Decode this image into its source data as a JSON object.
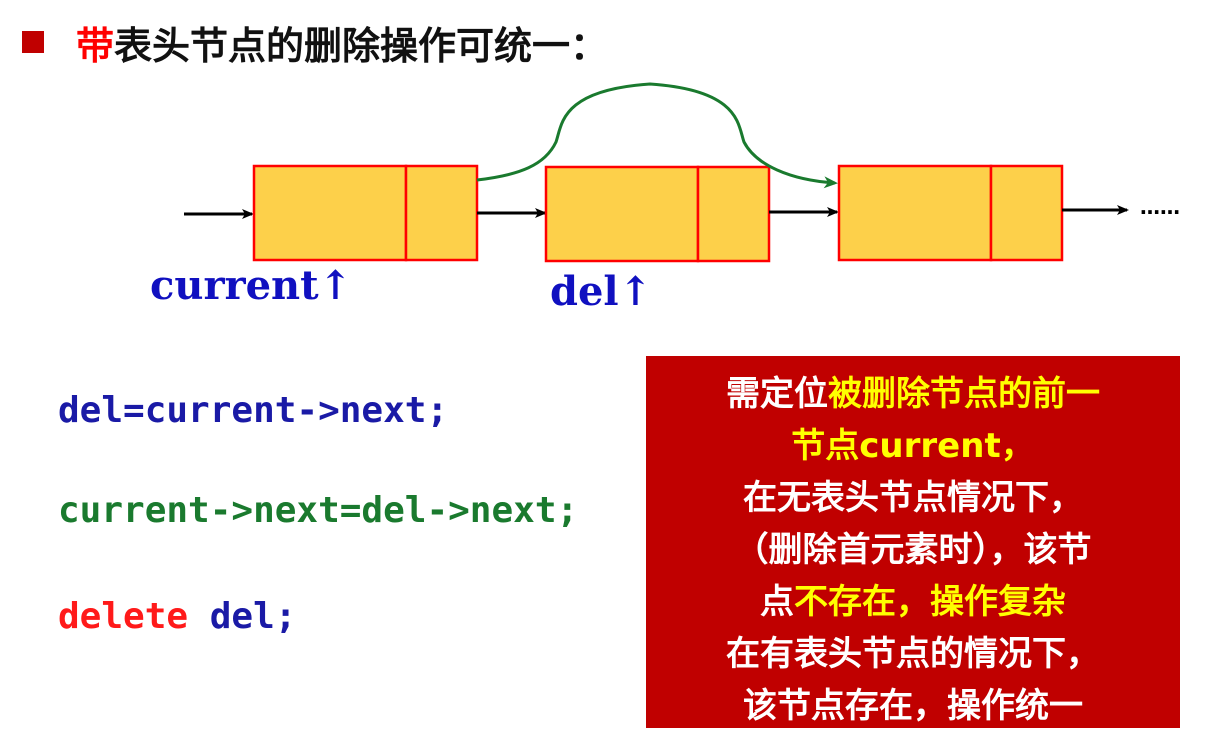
{
  "title": {
    "highlight": "带",
    "rest": "表头节点的删除操作可统一："
  },
  "diagram": {
    "ellipsis": "……",
    "labels": {
      "current": "current",
      "del": "del",
      "arrow": "↑"
    }
  },
  "code": {
    "line1": "del=current->next;",
    "line2": "current->next=del->next;",
    "line3_keyword": "delete",
    "line3_rest": " del;"
  },
  "note": {
    "l1_white": "需定位",
    "l1_yellow": "被删除节点的前一",
    "l2_yellow": "节点",
    "l2_white": "current，",
    "l3": "在无表头节点情况下，",
    "l4": "（删除首元素时），该节",
    "l5_white": "点",
    "l5_yellow": "不存在，操作复杂",
    "l6": "在有表头节点的情况下，",
    "l7": "该节点存在，操作统一"
  },
  "colors": {
    "node_fill": "#fdd04a",
    "node_border": "#ff0000",
    "bypass_arrow": "#1a7a2e",
    "label_blue": "#1010c0",
    "note_bg": "#c00000",
    "note_highlight": "#ffff00"
  }
}
